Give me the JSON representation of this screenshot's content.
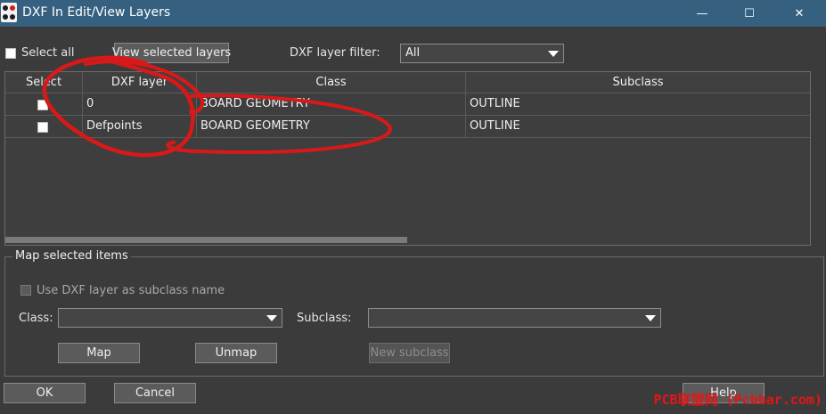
{
  "window": {
    "title": "DXF In Edit/View Layers",
    "minimize": "—",
    "maximize": "☐",
    "close": "✕"
  },
  "toolbar": {
    "select_all_label": "Select all",
    "view_selected_button": "View selected layers",
    "filter_label": "DXF layer filter:",
    "filter_value": "All"
  },
  "table": {
    "headers": {
      "select": "Select",
      "dxf_layer": "DXF layer",
      "class": "Class",
      "subclass": "Subclass"
    },
    "rows": [
      {
        "dxf_layer": "0",
        "class": "BOARD GEOMETRY",
        "subclass": "OUTLINE"
      },
      {
        "dxf_layer": "Defpoints",
        "class": "BOARD GEOMETRY",
        "subclass": "OUTLINE"
      }
    ]
  },
  "map_group": {
    "title": "Map selected items",
    "use_subclass_label": "Use DXF layer as subclass name",
    "class_label": "Class:",
    "class_value": "",
    "subclass_label": "Subclass:",
    "subclass_value": "",
    "map_button": "Map",
    "unmap_button": "Unmap",
    "new_subclass_button": "New subclass"
  },
  "footer": {
    "ok": "OK",
    "cancel": "Cancel",
    "help": "Help"
  },
  "watermark": "PCB联盟网 (Pcbbar.com)",
  "colors": {
    "titlebar": "#35607f",
    "background": "#3b3b3b",
    "annotation": "#e31616"
  }
}
